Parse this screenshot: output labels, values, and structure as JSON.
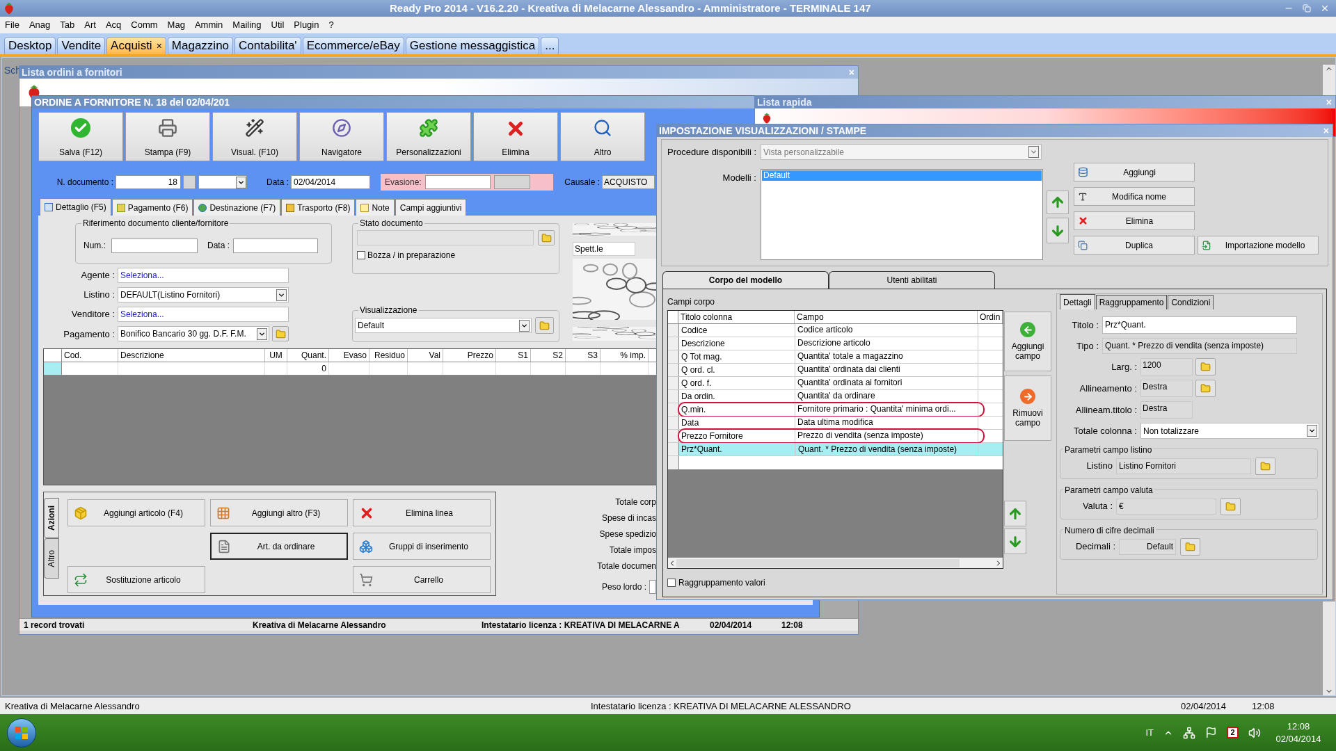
{
  "app": {
    "title": "Ready Pro 2014 - V16.2.20 - Kreativa di Melacarne Alessandro - Amministratore - TERMINALE 147",
    "menu": [
      "File",
      "Anag",
      "Tab",
      "Art",
      "Acq",
      "Comm",
      "Mag",
      "Ammin",
      "Mailing",
      "Util",
      "Plugin",
      "?"
    ],
    "tabs": [
      {
        "label": "Desktop",
        "selected": false
      },
      {
        "label": "Vendite",
        "selected": false
      },
      {
        "label": "Acquisti",
        "selected": true
      },
      {
        "label": "Magazzino",
        "selected": false
      },
      {
        "label": "Contabilita'",
        "selected": false
      },
      {
        "label": "Ecommerce/eBay",
        "selected": false
      },
      {
        "label": "Gestione messaggistica",
        "selected": false
      },
      {
        "label": "...",
        "selected": false
      }
    ],
    "tab_close": "×",
    "hidden_window_text": "Sch",
    "status_bar": [
      "Kreativa di Melacarne Alessandro",
      "Intestatario licenza : KREATIVA DI MELACARNE ALESSANDRO",
      "02/04/2014",
      "12:08"
    ]
  },
  "orders_list": {
    "title": "Lista ordini a fornitori",
    "close": "×",
    "status_bar": [
      "1 record trovati",
      "Kreativa di Melacarne Alessandro",
      "Intestatario licenza : KREATIVA DI MELACARNE A",
      "02/04/2014",
      "12:08"
    ]
  },
  "order": {
    "title": "ORDINE A FORNITORE N. 18 del 02/04/201",
    "toolbar": [
      "Salva (F12)",
      "Stampa (F9)",
      "Visual. (F10)",
      "Navigatore",
      "Personalizzazioni",
      "Elimina",
      "Altro"
    ],
    "header": {
      "number_label": "N. documento :",
      "number": "18",
      "date_label": "Data :",
      "date": "02/04/2014",
      "delivery_label": "Evasione:",
      "reason_label": "Causale :",
      "reason": "ACQUISTO"
    },
    "tabs": [
      {
        "label": "Dettaglio (F5)",
        "selected": true
      },
      {
        "label": "Pagamento (F6)",
        "selected": false
      },
      {
        "label": "Destinazione (F7)",
        "selected": false
      },
      {
        "label": "Trasporto (F8)",
        "selected": false
      },
      {
        "label": "Note",
        "selected": false
      },
      {
        "label": "Campi aggiuntivi",
        "selected": false
      }
    ],
    "reference": {
      "title": "Riferimento documento cliente/fornitore",
      "number_label": "Num.:",
      "date_label": "Data :"
    },
    "fields": [
      {
        "label": "Agente :",
        "value": "Seleziona...",
        "kind": "link"
      },
      {
        "label": "Listino :",
        "value": "DEFAULT(Listino Fornitori)",
        "kind": "dropdown"
      },
      {
        "label": "Venditore :",
        "value": "Seleziona...",
        "kind": "link"
      },
      {
        "label": "Pagamento :",
        "value": "Bonifico Bancario 30 gg. D.F. F.M.",
        "kind": "dropdown_folder"
      }
    ],
    "status": {
      "title": "Stato documento",
      "draft_label": "Bozza / in preparazione",
      "draft_checked": false
    },
    "view": {
      "title": "Visualizzazione",
      "value": "Default"
    },
    "salutation": "Spett.le",
    "grid": {
      "columns": [
        "Cod.",
        "Descrizione",
        "UM",
        "Quant.",
        "Evaso",
        "Residuo",
        "Val",
        "Prezzo",
        "S1",
        "S2",
        "S3",
        "% imp."
      ],
      "rows": [
        [
          "",
          "",
          "",
          "0",
          "",
          "",
          "",
          "",
          "",
          "",
          "",
          ""
        ]
      ]
    },
    "actions": {
      "tabs": [
        {
          "label": "Azioni",
          "selected": true
        },
        {
          "label": "Altro",
          "selected": false
        }
      ],
      "buttons": [
        {
          "label": "Aggiungi articolo (F4)",
          "focused": false
        },
        {
          "label": "Aggiungi altro (F3)",
          "focused": false
        },
        {
          "label": "Elimina linea",
          "focused": false
        },
        {
          "label": "Art. da ordinare",
          "focused": true
        },
        {
          "label": "Gruppi di inserimento",
          "focused": false
        },
        {
          "label": "Sostituzione articolo",
          "focused": false
        },
        {
          "label": "Carrello",
          "focused": false
        }
      ]
    },
    "totals": [
      "Totale corp",
      "Spese di incas",
      "Spese spedizio",
      "Totale impos",
      "Totale documen"
    ],
    "weight_label": "Peso lordo :"
  },
  "quick_list": {
    "title": "Lista rapida",
    "close": "×"
  },
  "settings": {
    "title": "IMPOSTAZIONE VISUALIZZAZIONI / STAMPE",
    "close": "×",
    "procedures_label": "Procedure disponibili :",
    "procedure": "Vista personalizzabile",
    "models_label": "Modelli :",
    "models": [
      {
        "name": "Default",
        "selected": true
      }
    ],
    "buttons": [
      "Aggiungi",
      "Modifica nome",
      "Elimina",
      "Duplica"
    ],
    "import_button": "Importazione modello",
    "tabs": [
      {
        "label": "Corpo del modello",
        "selected": true
      },
      {
        "label": "Utenti abilitati",
        "selected": false
      }
    ],
    "fields_label": "Campi corpo",
    "columns": [
      "Titolo colonna",
      "Campo",
      "Ordin"
    ],
    "rows": [
      {
        "title": "Codice",
        "field": "Codice articolo",
        "selected": false,
        "circled": false
      },
      {
        "title": "Descrizione",
        "field": "Descrizione articolo",
        "selected": false,
        "circled": false
      },
      {
        "title": "Q Tot mag.",
        "field": "Quantita' totale a magazzino",
        "selected": false,
        "circled": false
      },
      {
        "title": "Q ord. cl.",
        "field": "Quantita' ordinata dai clienti",
        "selected": false,
        "circled": false
      },
      {
        "title": "Q ord. f.",
        "field": "Quantita' ordinata ai fornitori",
        "selected": false,
        "circled": false
      },
      {
        "title": "Da ordin.",
        "field": "Quantita' da ordinare",
        "selected": false,
        "circled": false
      },
      {
        "title": "Q.min.",
        "field": "Fornitore primario : Quantita' minima ordi...",
        "selected": false,
        "circled": true
      },
      {
        "title": "Data",
        "field": "Data ultima modifica",
        "selected": false,
        "circled": false
      },
      {
        "title": "Prezzo Fornitore",
        "field": "Prezzo di vendita (senza imposte)",
        "selected": false,
        "circled": true
      },
      {
        "title": "Prz*Quant.",
        "field": "Quant. * Prezzo di vendita (senza imposte)",
        "selected": true,
        "circled": false
      }
    ],
    "add_field": "Aggiungi campo",
    "remove_field": "Rimuovi campo",
    "grouping": {
      "label": "Raggruppamento valori",
      "checked": false
    },
    "detail_tabs": [
      {
        "label": "Dettagli",
        "selected": true
      },
      {
        "label": "Raggruppamento",
        "selected": false
      },
      {
        "label": "Condizioni",
        "selected": false
      }
    ],
    "title_label": "Titolo :",
    "title_value": "Prz*Quant.",
    "type_label": "Tipo :",
    "type_value": "Quant. * Prezzo di vendita (senza imposte)",
    "width_label": "Larg. :",
    "width_value": "1200",
    "align_label": "Allineamento :",
    "align_value": "Destra",
    "title_align_label": "Allineam.titolo :",
    "title_align_value": "Destra",
    "total_label": "Totale colonna :",
    "total_value": "Non totalizzare",
    "groups": [
      {
        "title": "Parametri campo listino",
        "label": "Listino",
        "value": "Listino Fornitori"
      },
      {
        "title": "Parametri campo valuta",
        "label": "Valuta :",
        "value": "€"
      },
      {
        "title": "Numero di cifre decimali",
        "label": "Decimali :",
        "value": "Default"
      }
    ]
  },
  "taskbar": {
    "language": "IT",
    "calendar_badge": "2",
    "time": "12:08",
    "date": "02/04/2014"
  }
}
